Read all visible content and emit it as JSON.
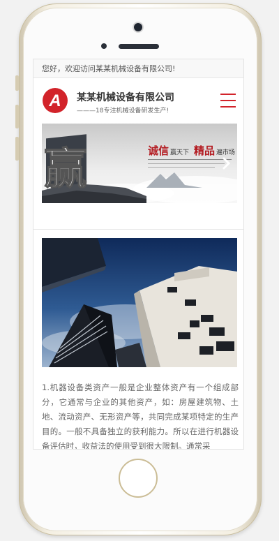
{
  "topbar": {
    "welcome": "您好，欢迎访问某某机械设备有限公司!"
  },
  "header": {
    "logo_letter": "A",
    "company": "某某机械设备有限公司",
    "slogan": "———18专注机械设备研发生产!",
    "menu_icon": "hamburger-menu-icon"
  },
  "banner": {
    "big_char": "赢",
    "slogan_a": "诚信",
    "slogan_b": "赢天下",
    "slogan_c": "精品",
    "slogan_d": "遍市场",
    "next_icon": "chevron-right-icon"
  },
  "article": {
    "text": "1.机器设备类资产一般是企业整体资产有一个组成部分，它通常与企业的其他资产，如：房屋建筑物、土地、流动资产、无形资产等，共同完成某项特定的生产目的。一般不具备独立的获利能力。所以在进行机器设备评估时，收益法的使用受到很大限制。通常采"
  },
  "colors": {
    "accent": "#d2232a",
    "text": "#666666"
  }
}
